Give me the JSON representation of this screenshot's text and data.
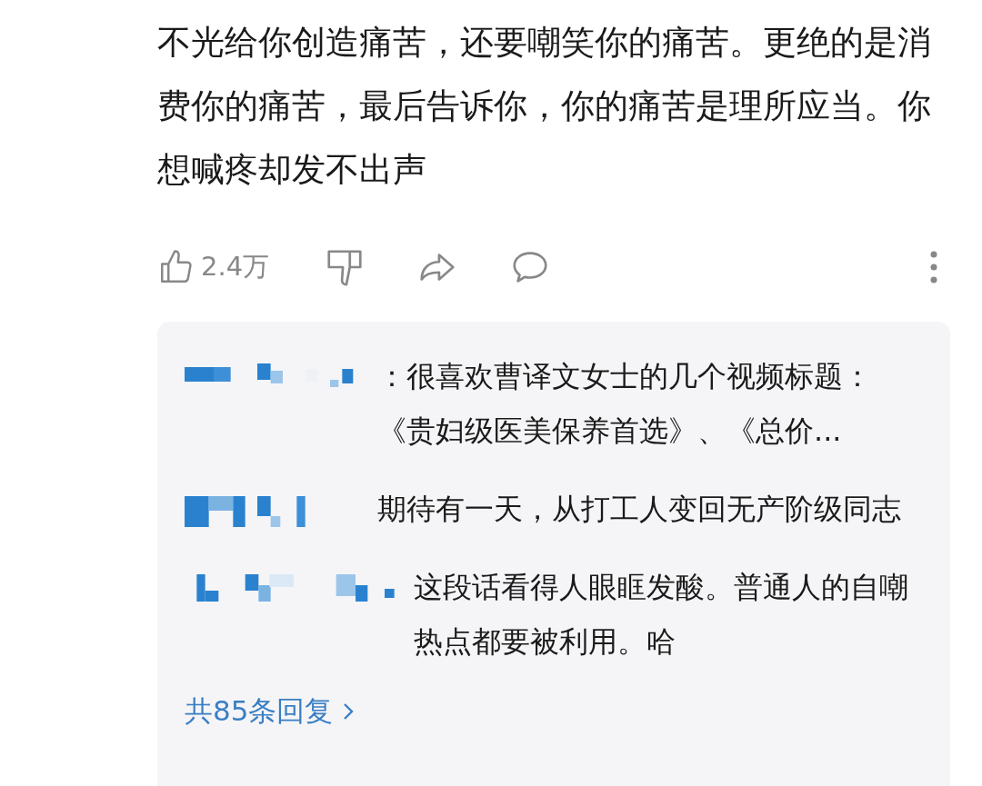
{
  "post": {
    "text": "不光给你创造痛苦，还要嘲笑你的痛苦。更绝的是消费你的痛苦，最后告诉你，你的痛苦是理所应当。你想喊疼却发不出声"
  },
  "actions": {
    "like_count": "2.4万"
  },
  "replies": [
    {
      "text": "：很喜欢曹译文女士的几个视频标题：《贵妇级医美保养首选》、《总价..."
    },
    {
      "text": "期待有一天，从打工人变回无产阶级同志"
    },
    {
      "text": "这段话看得人眼眶发酸。普通人的自嘲热点都要被利用。哈"
    }
  ],
  "more_replies": {
    "label": "共85条回复"
  }
}
